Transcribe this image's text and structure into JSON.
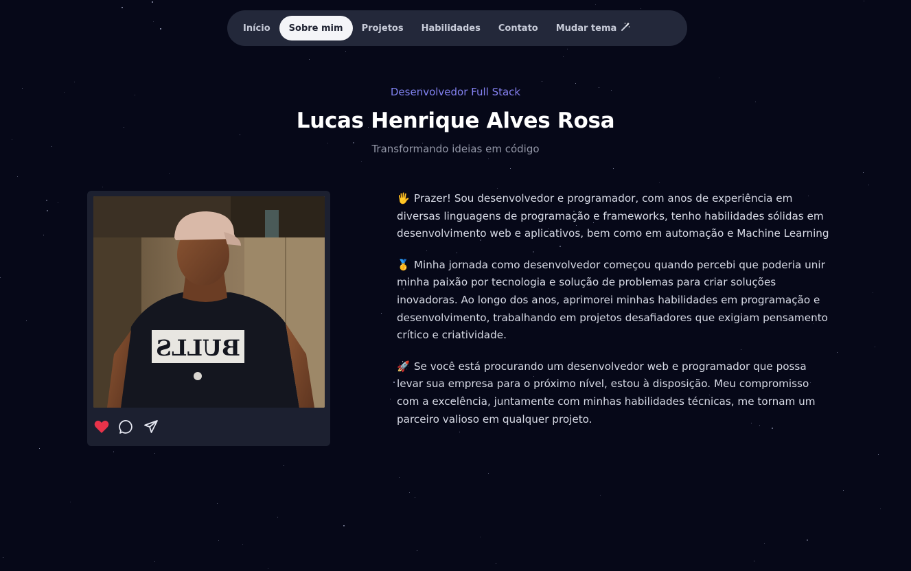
{
  "nav": {
    "items": [
      {
        "label": "Início",
        "active": false
      },
      {
        "label": "Sobre mim",
        "active": true
      },
      {
        "label": "Projetos",
        "active": false
      },
      {
        "label": "Habilidades",
        "active": false
      },
      {
        "label": "Contato",
        "active": false
      }
    ],
    "theme_label": "Mudar tema",
    "theme_icon": "magic-wand-icon"
  },
  "hero": {
    "role": "Desenvolvedor Full Stack",
    "name": "Lucas Henrique Alves Rosa",
    "tagline": "Transformando ideias em código"
  },
  "card": {
    "photo_shirt_text": "BULLS",
    "actions": [
      "heart-icon",
      "comment-icon",
      "share-icon"
    ]
  },
  "about": {
    "paragraphs": [
      {
        "emoji": "🖐️",
        "text": "Prazer! Sou desenvolvedor e programador, com anos de experiência em diversas linguagens de programação e frameworks, tenho habilidades sólidas em desenvolvimento web e aplicativos, bem como em automação e Machine Learning"
      },
      {
        "emoji": "🥇",
        "text": "Minha jornada como desenvolvedor começou quando percebi que poderia unir minha paixão por tecnologia e solução de problemas para criar soluções inovadoras. Ao longo dos anos, aprimorei minhas habilidades em programação e desenvolvimento, trabalhando em projetos desafiadores que exigiam pensamento crítico e criatividade."
      },
      {
        "emoji": "🚀",
        "text": "Se você está procurando um desenvolvedor web e programador que possa levar sua empresa para o próximo nível, estou à disposição. Meu compromisso com a excelência, juntamente com minhas habilidades técnicas, me tornam um parceiro valioso em qualquer projeto."
      }
    ]
  },
  "colors": {
    "background": "#060818",
    "nav_bg": "#23283a",
    "accent": "#7b6cf6",
    "heart": "#e8334a"
  }
}
